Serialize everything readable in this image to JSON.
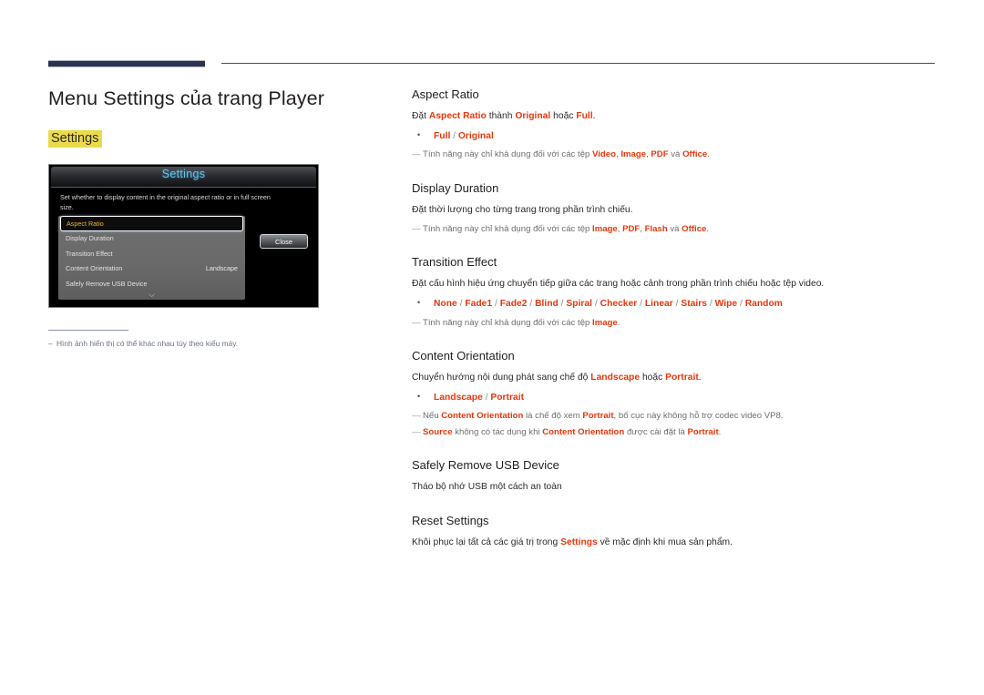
{
  "colors": {
    "accent_red": "#e8380d",
    "highlight_yellow": "#ebdb4a",
    "rule_navy": "#2e3252",
    "tv_title_blue": "#5fc7f5",
    "tv_selected_text": "#f0b429"
  },
  "header": {
    "page_title": "Menu Settings của trang Player",
    "highlight_heading": "Settings"
  },
  "tv_dialog": {
    "title": "Settings",
    "description": "Set whether to display content in the original aspect ratio or in full screen size.",
    "close_label": "Close",
    "scroll_icon": "chevron-down-icon",
    "rows": [
      {
        "label": "Aspect Ratio",
        "value": "",
        "selected": true
      },
      {
        "label": "Display Duration",
        "value": "",
        "selected": false
      },
      {
        "label": "Transition Effect",
        "value": "",
        "selected": false
      },
      {
        "label": "Content Orientation",
        "value": "Landscape",
        "selected": false
      },
      {
        "label": "Safely Remove USB Device",
        "value": "",
        "selected": false
      }
    ]
  },
  "image_footnote": {
    "dash": "–",
    "text": "Hình ảnh hiển thị có thể khác nhau tùy theo kiểu máy."
  },
  "sections": [
    {
      "title": "Aspect Ratio",
      "body_html": "Đặt <b class=\"k\">Aspect Ratio</b> thành <b class=\"k\">Original</b> hoặc <b class=\"k\">Full</b>.",
      "options_html": "Full <span class=\"sl\">/</span> Original",
      "notes_html": [
        "Tính năng này chỉ khả dụng đối với các tệp <b class=\"k\">Video</b>, <b class=\"k\">Image</b>, <b class=\"k\">PDF</b> và <b class=\"k\">Office</b>."
      ]
    },
    {
      "title": "Display Duration",
      "body_html": "Đặt thời lượng cho từng trang trong phần trình chiếu.",
      "options_html": "",
      "notes_html": [
        "Tính năng này chỉ khả dụng đối với các tệp <b class=\"k\">Image</b>, <b class=\"k\">PDF</b>, <b class=\"k\">Flash</b> và <b class=\"k\">Office</b>."
      ]
    },
    {
      "title": "Transition Effect",
      "body_html": "Đặt cấu hình hiệu ứng chuyển tiếp giữa các trang hoặc cảnh trong phần trình chiếu hoặc tệp video.",
      "options_html": "None <span class=\"sl\">/</span> Fade1 <span class=\"sl\">/</span> Fade2 <span class=\"sl\">/</span> Blind <span class=\"sl\">/</span> Spiral <span class=\"sl\">/</span> Checker <span class=\"sl\">/</span> Linear <span class=\"sl\">/</span> Stairs <span class=\"sl\">/</span> Wipe <span class=\"sl\">/</span> Random",
      "notes_html": [
        "Tính năng này chỉ khả dụng đối với các tệp <b class=\"k\">Image</b>."
      ]
    },
    {
      "title": "Content Orientation",
      "body_html": "Chuyển hướng nội dung phát sang chế độ <b class=\"k\">Landscape</b> hoặc <b class=\"k\">Portrait</b>.",
      "options_html": "Landscape <span class=\"sl\">/</span> Portrait",
      "notes_html": [
        "Nếu <b class=\"k\">Content Orientation</b> là chế độ xem <b class=\"k\">Portrait</b>, bố cục này không hỗ trợ codec video VP8.",
        "<b class=\"k\">Source</b> không có tác dụng khi <b class=\"k\">Content Orientation</b> được cài đặt là <b class=\"k\">Portrait</b>."
      ]
    },
    {
      "title": "Safely Remove USB Device",
      "body_html": "Tháo bộ nhớ USB một cách an toàn",
      "options_html": "",
      "notes_html": []
    },
    {
      "title": "Reset Settings",
      "body_html": "Khôi phục lại tất cả các giá trị trong <b class=\"k\">Settings</b> về mặc định khi mua sản phẩm.",
      "options_html": "",
      "notes_html": []
    }
  ]
}
